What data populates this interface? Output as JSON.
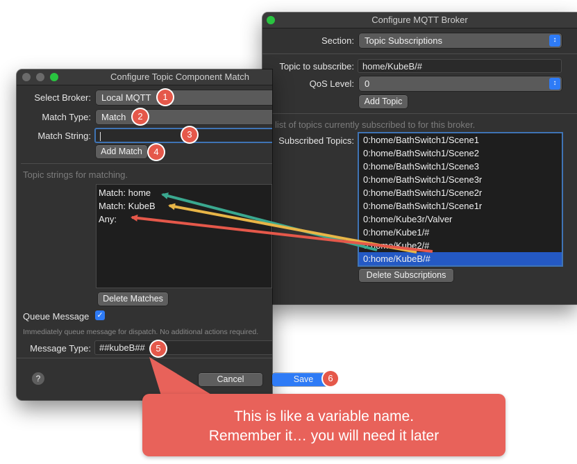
{
  "broker_window": {
    "title": "Configure MQTT Broker",
    "section_label": "Section:",
    "section_value": "Topic Subscriptions",
    "topic_label": "Topic to subscribe:",
    "topic_value": "home/KubeB/#",
    "qos_label": "QoS Level:",
    "qos_value": "0",
    "add_topic_label": "Add Topic",
    "list_hint": "The list of topics currently subscribed to for this broker.",
    "subscribed_label": "Subscribed Topics:",
    "subscribed_topics": [
      "0:home/BathSwitch1/Scene1",
      "0:home/BathSwitch1/Scene2",
      "0:home/BathSwitch1/Scene3",
      "0:home/BathSwitch1/Scene3r",
      "0:home/BathSwitch1/Scene2r",
      "0:home/BathSwitch1/Scene1r",
      "0:home/Kube3r/Valver",
      "0:home/Kube1/#",
      "0:home/Kube2/#",
      "0:home/KubeB/#"
    ],
    "selected_index": 9,
    "delete_subscriptions_label": "Delete Subscriptions"
  },
  "match_window": {
    "title": "Configure Topic Component Match",
    "select_broker_label": "Select Broker:",
    "select_broker_value": "Local MQTT",
    "match_type_label": "Match Type:",
    "match_type_value": "Match",
    "match_string_label": "Match String:",
    "match_string_value": "",
    "add_match_label": "Add Match",
    "matching_hint": "Topic strings for matching.",
    "matches": [
      "Match: home",
      "Match: KubeB",
      "Any:"
    ],
    "delete_matches_label": "Delete Matches",
    "queue_message_label": "Queue Message",
    "queue_message_checked": true,
    "queue_hint": "Immediately queue message for dispatch.  No additional actions required.",
    "message_type_label": "Message Type:",
    "message_type_value": "##kubeB##",
    "help_label": "?",
    "cancel_label": "Cancel",
    "save_label": "Save"
  },
  "badges": [
    "1",
    "2",
    "3",
    "4",
    "5",
    "6"
  ],
  "callout": {
    "line1": "This is like a variable name.",
    "line2": "Remember it… you will need it later"
  },
  "colors": {
    "accent": "#2e7bf6",
    "badge": "#e5584a",
    "callout": "#e8625a",
    "arrow_teal": "#3aa88f",
    "arrow_yellow": "#e8b547",
    "arrow_red": "#e5584a"
  },
  "icons": {
    "checkbox": "checkmark-icon",
    "popup": "chevron-updown-icon"
  }
}
